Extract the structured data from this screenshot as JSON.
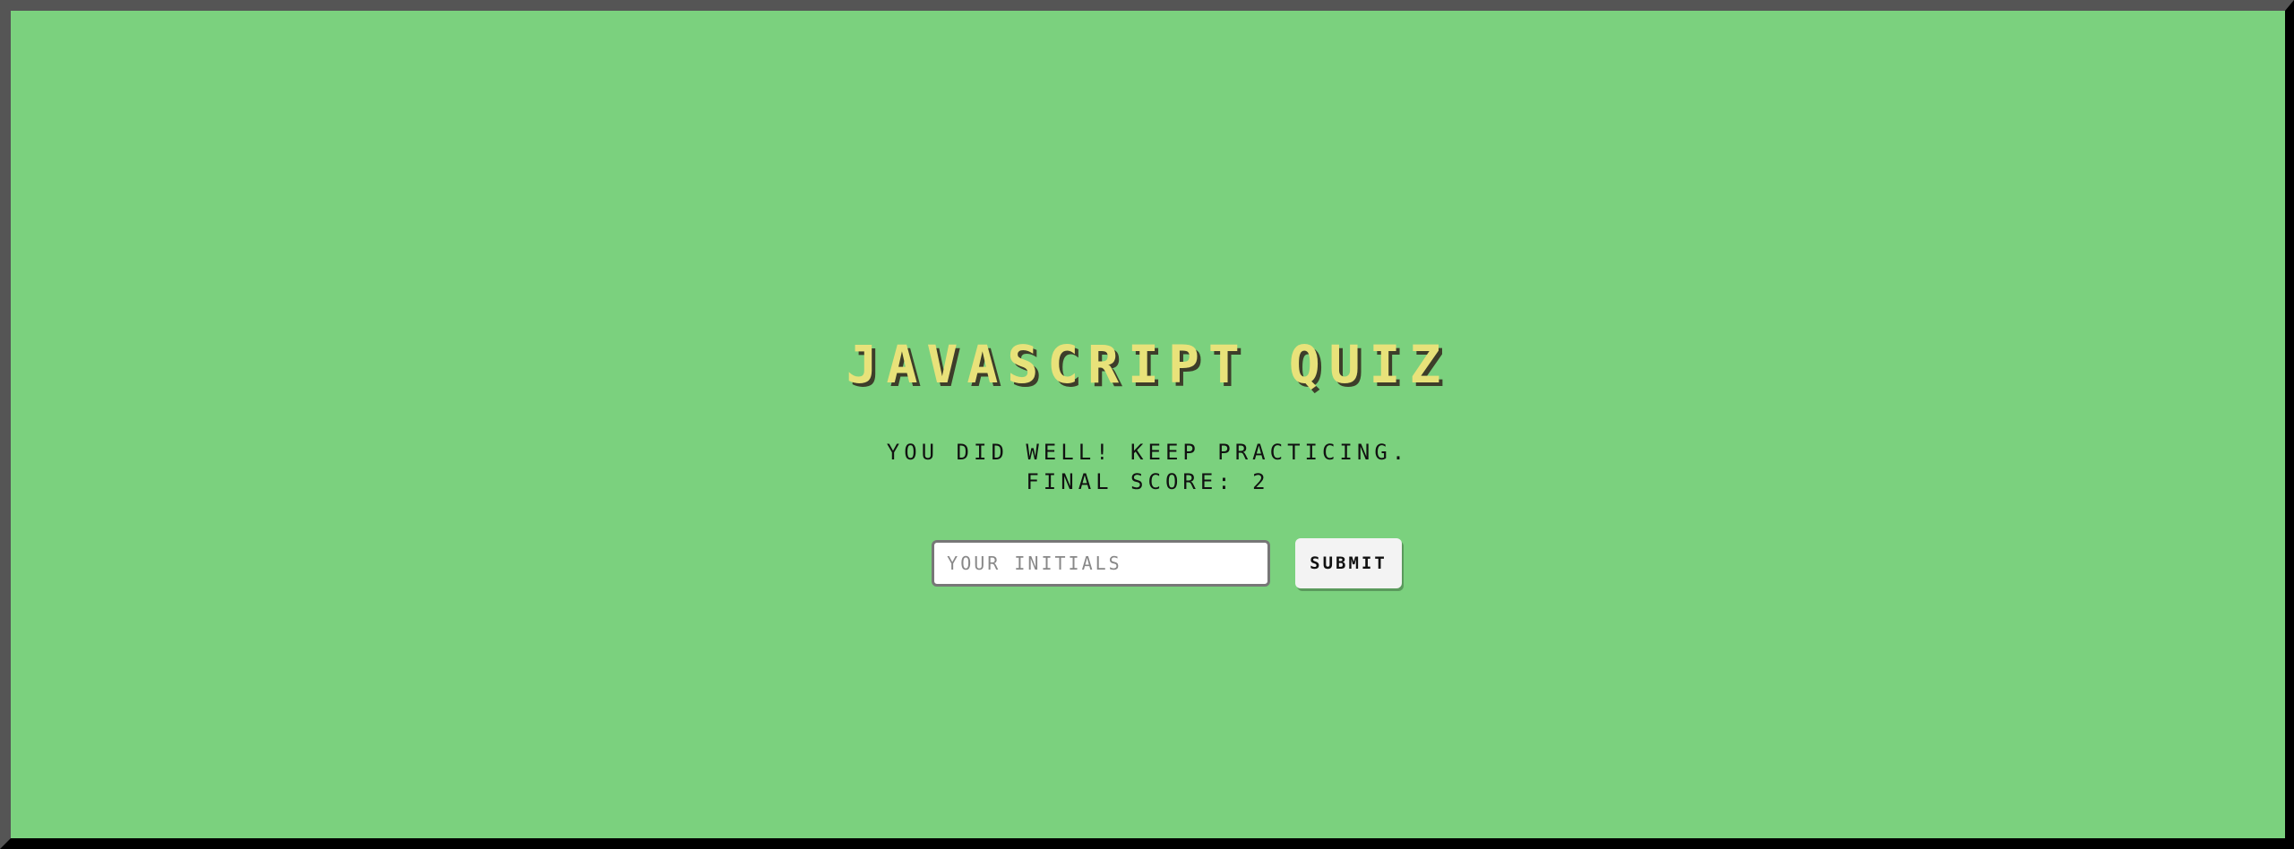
{
  "quiz": {
    "title": "JAVASCRIPT QUIZ"
  },
  "result": {
    "message": "YOU DID WELL! KEEP PRACTICING.",
    "score_label": "FINAL SCORE: 2",
    "score": 2
  },
  "form": {
    "initials_placeholder": "YOUR INITIALS",
    "initials_value": "",
    "submit_label": "SUBMIT"
  },
  "colors": {
    "background": "#7bd17e",
    "title": "#e8e27a",
    "title_shadow": "#3d3d2a",
    "text": "#111111",
    "button_background": "#f3f3f3"
  }
}
